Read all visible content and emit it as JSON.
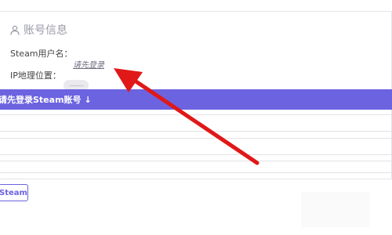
{
  "account_card": {
    "title": "账号信息",
    "title_icon": "user-icon",
    "steam_user_label": "Steam用户名：",
    "steam_user_value": "请先登录",
    "ip_location_label": "IP地理位置：",
    "ip_location_value": "——"
  },
  "login_bar": {
    "label": "请先登录Steam账号",
    "icon": "arrow-down-icon"
  },
  "bottom_button": {
    "label": "Steam"
  },
  "colors": {
    "accent": "#6c63e0",
    "annotation_arrow": "#e01818"
  }
}
